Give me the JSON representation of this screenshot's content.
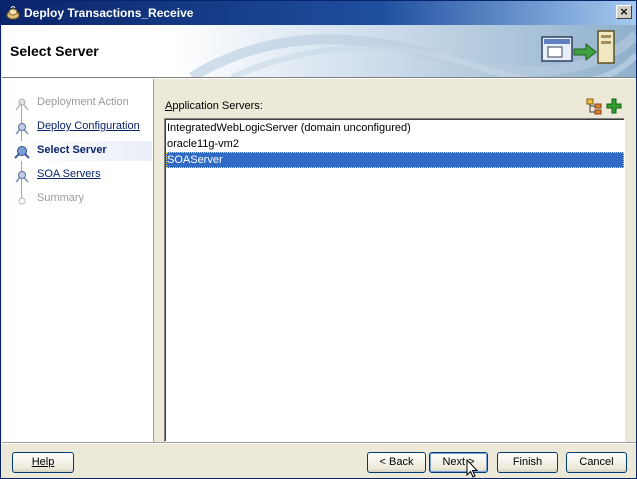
{
  "window": {
    "title": "Deploy Transactions_Receive",
    "close_label": "×"
  },
  "header": {
    "title": "Select Server"
  },
  "nav": {
    "items": [
      {
        "label": "Deployment Action",
        "state": "disabled"
      },
      {
        "label": "Deploy Configuration",
        "state": "link"
      },
      {
        "label": "Select Server",
        "state": "current"
      },
      {
        "label": "SOA Servers",
        "state": "link"
      },
      {
        "label": "Summary",
        "state": "disabled"
      }
    ]
  },
  "content": {
    "label_prefix": "A",
    "label_rest": "pplication Servers:",
    "servers": [
      {
        "name": "IntegratedWebLogicServer (domain unconfigured)",
        "selected": false
      },
      {
        "name": "oracle11g-vm2",
        "selected": false
      },
      {
        "name": "SOAServer",
        "selected": true
      }
    ]
  },
  "buttons": {
    "help": "Help",
    "back": "< Back",
    "next": "Next >",
    "finish": "Finish",
    "cancel": "Cancel"
  },
  "colors": {
    "selection": "#316ac5",
    "title_bar": "#0a246a",
    "link": "#0a246a"
  }
}
